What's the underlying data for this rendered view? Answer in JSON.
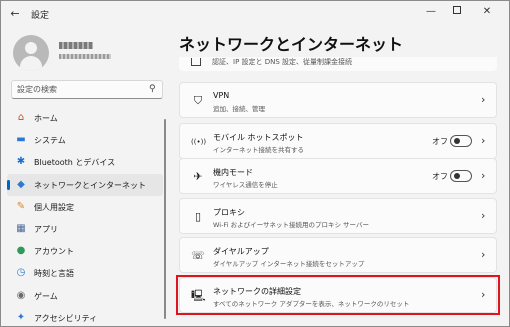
{
  "titlebar": {
    "back_icon": "back-arrow-icon",
    "title": "設定",
    "minimize_glyph": "—",
    "close_glyph": "✕"
  },
  "search": {
    "placeholder": "設定の検索",
    "icon": "search-icon"
  },
  "nav": [
    {
      "label": "ホーム",
      "icon": "home-icon",
      "glyph": "⌂",
      "color": "#c44a2c",
      "selected": false
    },
    {
      "label": "システム",
      "icon": "system-icon",
      "glyph": "▬",
      "color": "#2a7ad3",
      "selected": false
    },
    {
      "label": "Bluetooth とデバイス",
      "icon": "bluetooth-icon",
      "glyph": "✱",
      "color": "#1b6fd0",
      "selected": false
    },
    {
      "label": "ネットワークとインターネット",
      "icon": "network-icon",
      "glyph": "◆",
      "color": "#2a7ad3",
      "selected": true
    },
    {
      "label": "個人用設定",
      "icon": "personalization-icon",
      "glyph": "✎",
      "color": "#d6862b",
      "selected": false
    },
    {
      "label": "アプリ",
      "icon": "apps-icon",
      "glyph": "▦",
      "color": "#4a6a9a",
      "selected": false
    },
    {
      "label": "アカウント",
      "icon": "account-icon",
      "glyph": "●",
      "color": "#2f9a5a",
      "selected": false
    },
    {
      "label": "時刻と言語",
      "icon": "time-language-icon",
      "glyph": "◷",
      "color": "#2a7ad3",
      "selected": false
    },
    {
      "label": "ゲーム",
      "icon": "gaming-icon",
      "glyph": "◉",
      "color": "#6a6a6a",
      "selected": false
    },
    {
      "label": "アクセシビリティ",
      "icon": "accessibility-icon",
      "glyph": "✦",
      "color": "#2a7ad3",
      "selected": false
    }
  ],
  "main": {
    "page_title": "ネットワークとインターネット",
    "cut_row_text": "認証、IP 設定と DNS 設定、従量制課金接続",
    "cards": [
      {
        "key": "vpn",
        "title": "VPN",
        "subtitle": "追加、接続、管理",
        "icon": "vpn-shield-icon",
        "glyph": "⛉",
        "toggle": null
      },
      {
        "key": "hotspot",
        "title": "モバイル ホットスポット",
        "subtitle": "インターネット接続を共有する",
        "icon": "hotspot-icon",
        "glyph": "((•))",
        "toggle": "オフ"
      },
      {
        "key": "airplane",
        "title": "機内モード",
        "subtitle": "ワイヤレス通信を停止",
        "icon": "airplane-icon",
        "glyph": "✈",
        "toggle": "オフ"
      },
      {
        "key": "proxy",
        "title": "プロキシ",
        "subtitle": "Wi-Fi およびイーサネット接続用のプロキシ サーバー",
        "icon": "proxy-icon",
        "glyph": "▯",
        "toggle": null
      },
      {
        "key": "dialup",
        "title": "ダイヤルアップ",
        "subtitle": "ダイヤルアップ インターネット接続をセットアップ",
        "icon": "dialup-icon",
        "glyph": "☏",
        "toggle": null
      },
      {
        "key": "advanced",
        "title": "ネットワークの詳細設定",
        "subtitle": "すべてのネットワーク アダプターを表示、ネットワークのリセット",
        "icon": "advanced-network-icon",
        "glyph": "🖳",
        "toggle": null
      }
    ],
    "chevron_glyph": "›"
  },
  "colors": {
    "highlight": "#e0141e",
    "accent": "#0067c0"
  }
}
